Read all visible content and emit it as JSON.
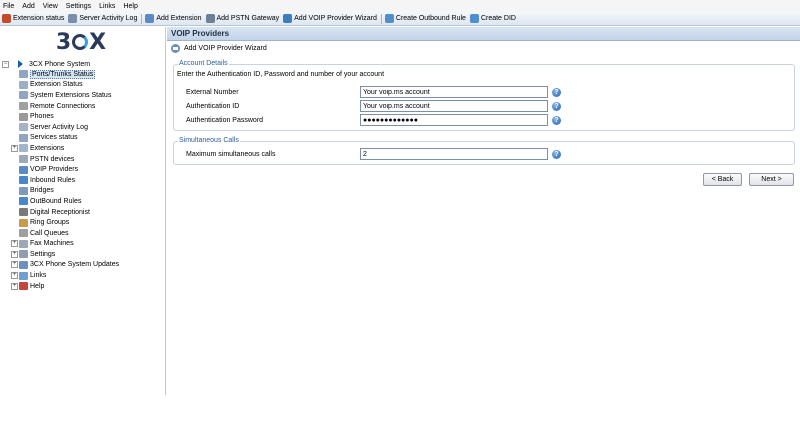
{
  "menu": [
    "File",
    "Add",
    "View",
    "Settings",
    "Links",
    "Help"
  ],
  "toolbar": [
    {
      "label": "Extension status",
      "icon": "extension-status-icon",
      "color": "#c24b2a"
    },
    {
      "label": "Server Activity Log",
      "icon": "log-icon",
      "color": "#7a8fa8"
    },
    {
      "label": "Add Extension",
      "icon": "add-extension-icon",
      "color": "#5b8bc4"
    },
    {
      "label": "Add PSTN Gateway",
      "icon": "gateway-icon",
      "color": "#6f7f95"
    },
    {
      "label": "Add VOIP Provider Wizard",
      "icon": "voip-icon",
      "color": "#3d7cc0"
    },
    {
      "label": "Create Outbound Rule",
      "icon": "outbound-icon",
      "color": "#4f8fd0"
    },
    {
      "label": "Create DID",
      "icon": "did-icon",
      "color": "#4f8fd0"
    }
  ],
  "tree": {
    "root": "3CX Phone System",
    "items": [
      {
        "label": "Ports/Trunks Status",
        "icon": "ports-icon",
        "selected": true
      },
      {
        "label": "Extension Status",
        "icon": "extension-icon"
      },
      {
        "label": "System Extensions Status",
        "icon": "system-extension-icon"
      },
      {
        "label": "Remote Connections",
        "icon": "remote-icon"
      },
      {
        "label": "Phones",
        "icon": "phone-icon"
      },
      {
        "label": "Server Activity Log",
        "icon": "log-icon"
      },
      {
        "label": "Services status",
        "icon": "services-icon"
      },
      {
        "label": "Extensions",
        "icon": "extensions-icon",
        "group": true
      },
      {
        "label": "PSTN devices",
        "icon": "pstn-icon"
      },
      {
        "label": "VOIP Providers",
        "icon": "voip-icon"
      },
      {
        "label": "Inbound Rules",
        "icon": "inbound-icon"
      },
      {
        "label": "Bridges",
        "icon": "bridges-icon"
      },
      {
        "label": "OutBound Rules",
        "icon": "outbound-icon"
      },
      {
        "label": "Digital Receptionist",
        "icon": "receptionist-icon"
      },
      {
        "label": "Ring Groups",
        "icon": "ring-groups-icon"
      },
      {
        "label": "Call Queues",
        "icon": "call-queues-icon"
      },
      {
        "label": "Fax Machines",
        "icon": "fax-icon",
        "group": true
      },
      {
        "label": "Settings",
        "icon": "settings-icon",
        "group": true
      },
      {
        "label": "3CX Phone System Updates",
        "icon": "updates-icon",
        "group": true
      },
      {
        "label": "Links",
        "icon": "links-icon",
        "group": true
      },
      {
        "label": "Help",
        "icon": "help-icon",
        "group": true
      }
    ]
  },
  "panel": {
    "title": "VOIP Providers",
    "wizard_label": "Add VOIP Provider Wizard",
    "account": {
      "legend": "Account Details",
      "instruction": "Enter the Authentication ID, Password and number of your account",
      "external_number_label": "External Number",
      "external_number_value": "Your voip.ms account",
      "auth_id_label": "Authentication ID",
      "auth_id_value": "Your voip.ms account",
      "auth_password_label": "Authentication Password",
      "auth_password_value": "●●●●●●●●●●●●●"
    },
    "calls": {
      "legend": "Simultaneous Calls",
      "max_label": "Maximum simultaneous calls",
      "max_value": "2"
    },
    "back_label": "< Back",
    "next_label": "Next >"
  },
  "colors": {
    "accent": "#2e5fa0",
    "header_bg": "#c3d3e8",
    "selection": "#d6e4f4"
  }
}
